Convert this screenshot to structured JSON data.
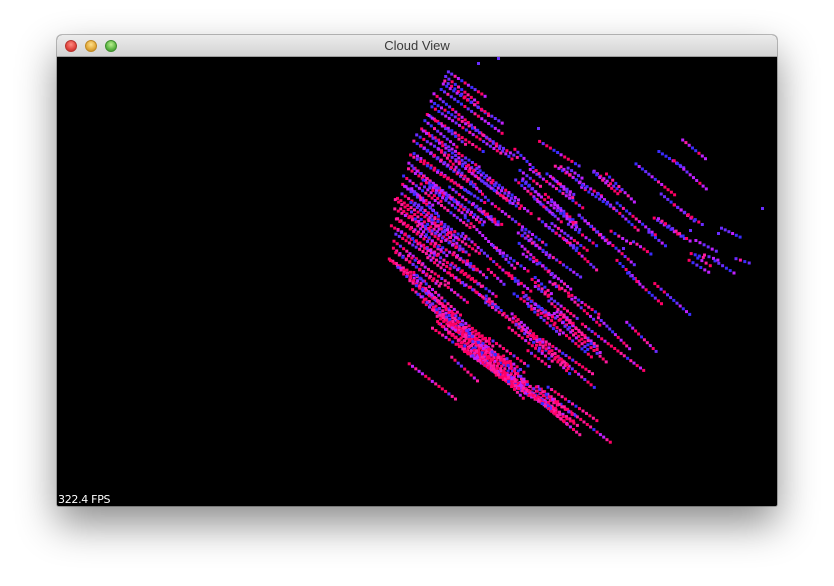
{
  "window": {
    "title": "Cloud View"
  },
  "titlebar_buttons": [
    {
      "name": "close-button",
      "color": "#e0443e"
    },
    {
      "name": "minimize-button",
      "color": "#e2a93a"
    },
    {
      "name": "zoom-button",
      "color": "#5cb543"
    }
  ],
  "viewport": {
    "background": "#000000",
    "point_colors": [
      "#ff0066",
      "#ff1aa0",
      "#c020ff",
      "#6a2cff",
      "#3a2cff"
    ],
    "fps_label": "322.4 FPS"
  }
}
